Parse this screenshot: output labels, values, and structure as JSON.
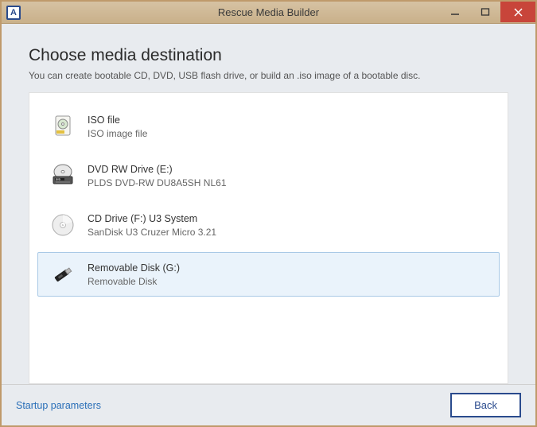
{
  "window": {
    "title": "Rescue Media Builder",
    "icon_letter": "A"
  },
  "page": {
    "heading": "Choose media destination",
    "subheading": "You can create bootable CD, DVD, USB flash drive, or build an .iso image of a bootable disc."
  },
  "destinations": [
    {
      "title": "ISO file",
      "subtitle": "ISO image file",
      "icon": "iso",
      "selected": false
    },
    {
      "title": "DVD RW Drive (E:)",
      "subtitle": "PLDS DVD-RW DU8A5SH NL61",
      "icon": "dvd",
      "selected": false
    },
    {
      "title": "CD Drive (F:) U3 System",
      "subtitle": "SanDisk U3 Cruzer Micro 3.21",
      "icon": "cd",
      "selected": false
    },
    {
      "title": "Removable Disk (G:)",
      "subtitle": "Removable Disk",
      "icon": "usb",
      "selected": true
    }
  ],
  "footer": {
    "startup_link": "Startup parameters",
    "back_label": "Back"
  }
}
